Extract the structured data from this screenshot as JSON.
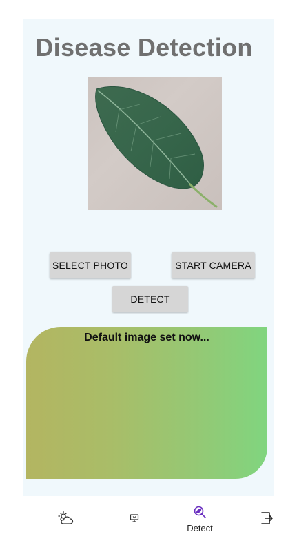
{
  "page": {
    "title": "Disease Detection"
  },
  "preview": {
    "subject": "leaf-photo"
  },
  "buttons": {
    "select_photo": "SELECT PHOTO",
    "start_camera": "START CAMERA",
    "detect": "DETECT"
  },
  "result": {
    "message": "Default image set now..."
  },
  "bottom_nav": {
    "items": [
      {
        "icon": "partly-cloudy-icon",
        "label": ""
      },
      {
        "icon": "monitor-icon",
        "label": ""
      },
      {
        "icon": "leaf-scan-icon",
        "label": "Detect",
        "active": true
      },
      {
        "icon": "exit-icon",
        "label": ""
      }
    ]
  },
  "colors": {
    "title": "#707070",
    "content_background": "#f0f8fc",
    "button_background": "#d6d6d6",
    "result_gradient_start": "#b3b561",
    "result_gradient_end": "#80d57f",
    "active_nav": "#6a2fc0"
  }
}
